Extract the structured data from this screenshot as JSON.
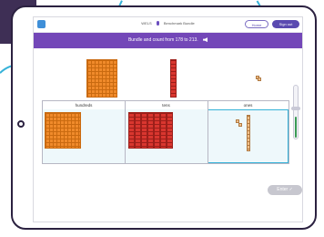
{
  "header": {
    "student_name": "WELS",
    "page_title": "Benchmark Bundle",
    "home_label": "Home",
    "signout_label": "Sign out"
  },
  "banner": {
    "instruction": "Bundle and count from 178 to 213."
  },
  "table": {
    "columns": [
      "hundreds",
      "tens",
      "ones"
    ]
  },
  "enter_label": "Enter ✓",
  "colors": {
    "banner": "#7347b8",
    "hundreds": "#f08a2a",
    "tens": "#d9362f",
    "ones": "#f3c18a",
    "selection": "#36b2d8"
  }
}
